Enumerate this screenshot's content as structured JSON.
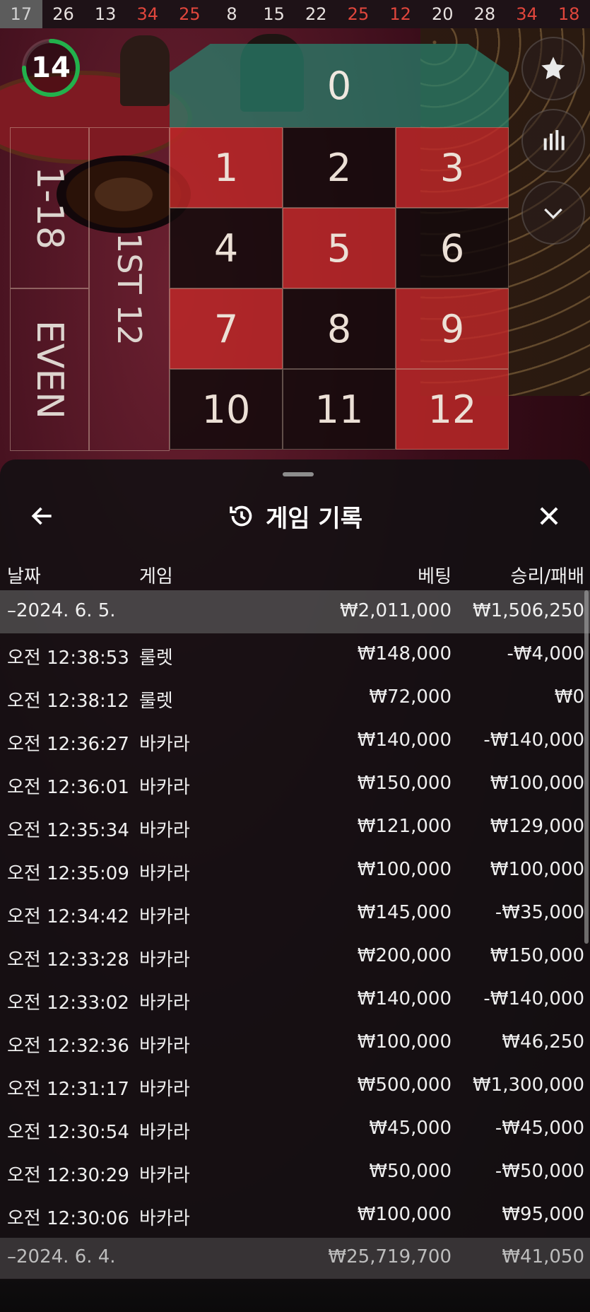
{
  "history": [
    {
      "n": "17",
      "color": "gray"
    },
    {
      "n": "26",
      "color": "white"
    },
    {
      "n": "13",
      "color": "white"
    },
    {
      "n": "34",
      "color": "red"
    },
    {
      "n": "25",
      "color": "red"
    },
    {
      "n": "8",
      "color": "white"
    },
    {
      "n": "15",
      "color": "white"
    },
    {
      "n": "22",
      "color": "white"
    },
    {
      "n": "25",
      "color": "red"
    },
    {
      "n": "12",
      "color": "red"
    },
    {
      "n": "20",
      "color": "white"
    },
    {
      "n": "28",
      "color": "white"
    },
    {
      "n": "34",
      "color": "red"
    },
    {
      "n": "18",
      "color": "red"
    }
  ],
  "timer": {
    "value": "14",
    "progress": 0.75,
    "color": "#22b14c"
  },
  "table": {
    "zero": "0",
    "cells": [
      {
        "n": "1",
        "c": "r"
      },
      {
        "n": "2",
        "c": "b"
      },
      {
        "n": "3",
        "c": "r"
      },
      {
        "n": "4",
        "c": "b"
      },
      {
        "n": "5",
        "c": "r"
      },
      {
        "n": "6",
        "c": "b"
      },
      {
        "n": "7",
        "c": "r"
      },
      {
        "n": "8",
        "c": "b"
      },
      {
        "n": "9",
        "c": "r"
      },
      {
        "n": "10",
        "c": "b"
      },
      {
        "n": "11",
        "c": "b"
      },
      {
        "n": "12",
        "c": "r"
      }
    ],
    "outside": {
      "low": "1-18",
      "even": "EVEN",
      "dozen": "1ST 12"
    }
  },
  "side_buttons": [
    "star-icon",
    "stats-icon",
    "chevron-down-icon"
  ],
  "sheet": {
    "title": "게임 기록",
    "columns": {
      "date": "날짜",
      "game": "게임",
      "bet": "베팅",
      "result": "승리/패배"
    },
    "groups": [
      {
        "date": "–2024. 6. 5.",
        "bet": "₩2,011,000",
        "result": "₩1,506,250"
      }
    ],
    "rows": [
      {
        "time": "오전 12:38:53",
        "game": "룰렛",
        "bet": "₩148,000",
        "result": "-₩4,000"
      },
      {
        "time": "오전 12:38:12",
        "game": "룰렛",
        "bet": "₩72,000",
        "result": "₩0"
      },
      {
        "time": "오전 12:36:27",
        "game": "바카라",
        "bet": "₩140,000",
        "result": "-₩140,000"
      },
      {
        "time": "오전 12:36:01",
        "game": "바카라",
        "bet": "₩150,000",
        "result": "₩100,000"
      },
      {
        "time": "오전 12:35:34",
        "game": "바카라",
        "bet": "₩121,000",
        "result": "₩129,000"
      },
      {
        "time": "오전 12:35:09",
        "game": "바카라",
        "bet": "₩100,000",
        "result": "₩100,000"
      },
      {
        "time": "오전 12:34:42",
        "game": "바카라",
        "bet": "₩145,000",
        "result": "-₩35,000"
      },
      {
        "time": "오전 12:33:28",
        "game": "바카라",
        "bet": "₩200,000",
        "result": "₩150,000"
      },
      {
        "time": "오전 12:33:02",
        "game": "바카라",
        "bet": "₩140,000",
        "result": "-₩140,000"
      },
      {
        "time": "오전 12:32:36",
        "game": "바카라",
        "bet": "₩100,000",
        "result": "₩46,250"
      },
      {
        "time": "오전 12:31:17",
        "game": "바카라",
        "bet": "₩500,000",
        "result": "₩1,300,000"
      },
      {
        "time": "오전 12:30:54",
        "game": "바카라",
        "bet": "₩45,000",
        "result": "-₩45,000"
      },
      {
        "time": "오전 12:30:29",
        "game": "바카라",
        "bet": "₩50,000",
        "result": "-₩50,000"
      },
      {
        "time": "오전 12:30:06",
        "game": "바카라",
        "bet": "₩100,000",
        "result": "₩95,000"
      }
    ],
    "next_group": {
      "date": "–2024. 6. 4.",
      "bet": "₩25,719,700",
      "result": "₩41,050"
    }
  }
}
